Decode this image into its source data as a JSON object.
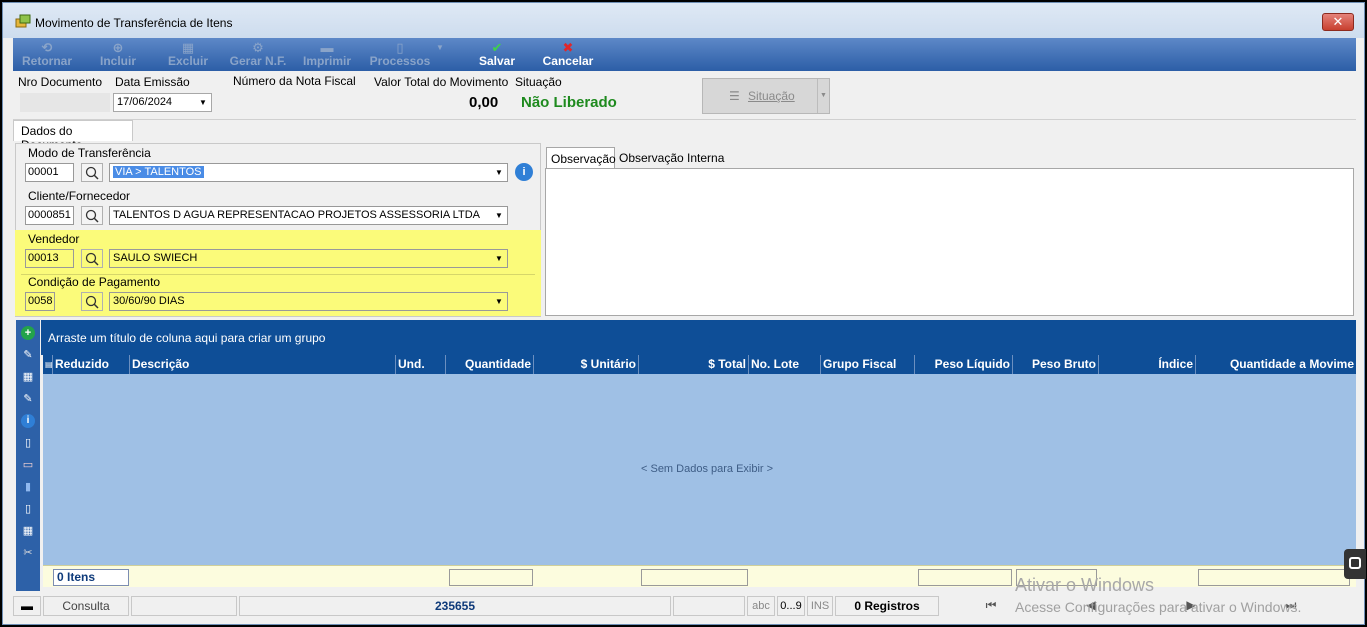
{
  "window": {
    "title": "Movimento de Transferência de Itens",
    "close_label": "✕"
  },
  "toolbar": {
    "retornar": "Retornar",
    "incluir": "Incluir",
    "excluir": "Excluir",
    "gerar_nf": "Gerar N.F.",
    "imprimir": "Imprimir",
    "processos": "Processos",
    "salvar": "Salvar",
    "cancelar": "Cancelar"
  },
  "header": {
    "nro_documento_label": "Nro Documento",
    "nro_documento_value": "",
    "data_emissao_label": "Data Emissão",
    "data_emissao_value": "17/06/2024",
    "nota_fiscal_label": "Número da Nota Fiscal",
    "valor_total_label": "Valor Total do Movimento",
    "valor_total_value": "0,00",
    "situacao_label": "Situação",
    "situacao_value": "Não Liberado",
    "situacao_button": "Situação"
  },
  "tabs": {
    "dados_documento": "Dados do Documento"
  },
  "form": {
    "modo_label": "Modo de Transferência",
    "modo_code": "00001",
    "modo_value": "VIA > TALENTOS",
    "cliente_label": "Cliente/Fornecedor",
    "cliente_code": "0000851",
    "cliente_value": "TALENTOS D AGUA REPRESENTACAO PROJETOS ASSESSORIA LTDA",
    "vendedor_label": "Vendedor",
    "vendedor_code": "00013",
    "vendedor_value": "SAULO SWIECH",
    "condicao_label": "Condição de Pagamento",
    "condicao_code": "0058",
    "condicao_value": "30/60/90 DIAS"
  },
  "obs_tabs": {
    "observacao": "Observação",
    "observacao_interna": "Observação Interna"
  },
  "grid": {
    "group_hint": "Arraste um título de coluna aqui para criar um grupo",
    "columns": [
      "Reduzido",
      "Descrição",
      "Und.",
      "Quantidade",
      "$ Unitário",
      "$ Total",
      "No. Lote",
      "Grupo Fiscal",
      "Peso Líquido",
      "Peso Bruto",
      "Índice",
      "Quantidade a Movime"
    ],
    "empty_text": "< Sem Dados para Exibir >",
    "footer_items": "0 Itens"
  },
  "statusbar": {
    "mode": "Consulta",
    "user_code": "235655",
    "abc": "abc",
    "digits": "0...9",
    "ins": "INS",
    "registros": "0 Registros"
  },
  "watermark": {
    "line1": "Ativar o Windows",
    "line2": "Acesse Configurações para ativar o Windows."
  },
  "colors": {
    "toolbar": "#2c5ea7",
    "grid_header": "#0e4e97",
    "grid_body": "#9fc0e5",
    "highlight": "#fbfb7a",
    "status_green": "#1e8a1e"
  }
}
